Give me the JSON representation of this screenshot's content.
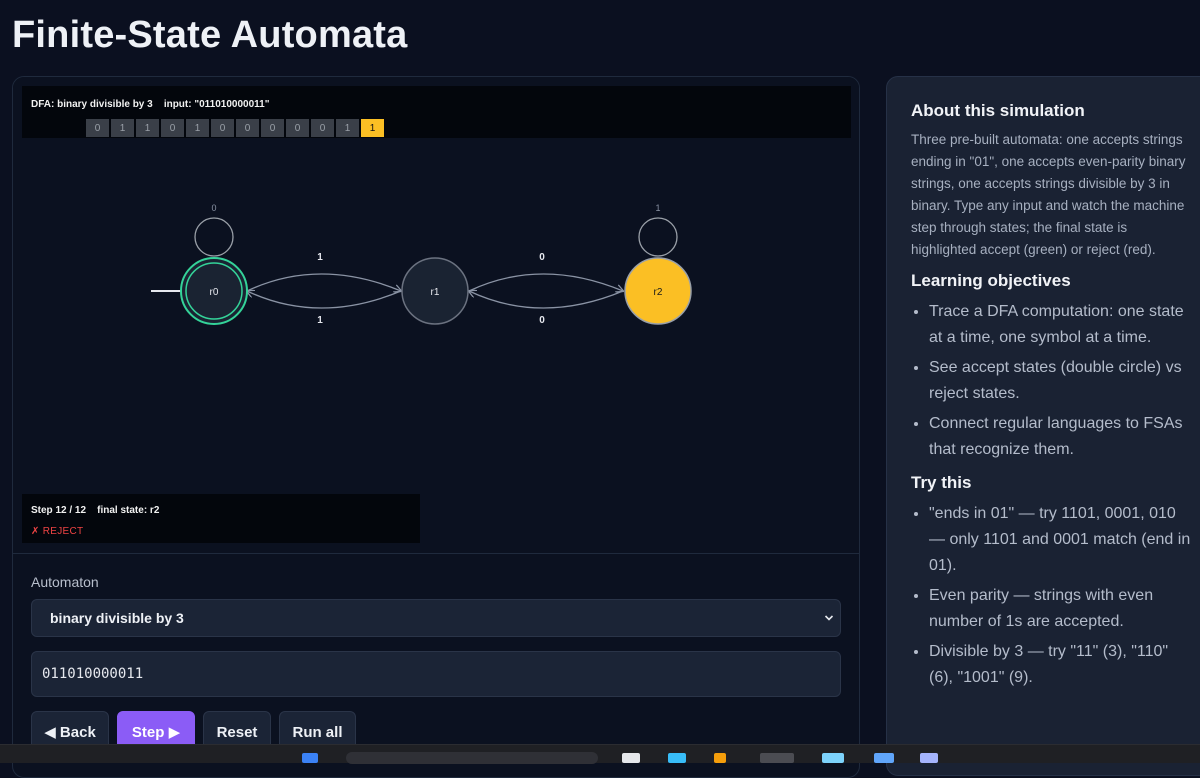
{
  "page": {
    "title": "Finite-State Automata"
  },
  "simulation": {
    "header_label": "DFA: binary divisible by 3    input: \"011010000011\"",
    "tape": [
      "0",
      "1",
      "1",
      "0",
      "1",
      "0",
      "0",
      "0",
      "0",
      "0",
      "1",
      "1"
    ],
    "active_index": 11,
    "states": [
      {
        "id": "r0",
        "label": "r0",
        "start": true,
        "accept": true,
        "active": false,
        "self_loop": "0"
      },
      {
        "id": "r1",
        "label": "r1",
        "start": false,
        "accept": false,
        "active": false,
        "self_loop": null
      },
      {
        "id": "r2",
        "label": "r2",
        "start": false,
        "accept": false,
        "active": true,
        "self_loop": "1"
      }
    ],
    "transitions": [
      {
        "from": "r0",
        "to": "r1",
        "label": "1"
      },
      {
        "from": "r1",
        "to": "r0",
        "label": "1"
      },
      {
        "from": "r1",
        "to": "r2",
        "label": "0"
      },
      {
        "from": "r2",
        "to": "r1",
        "label": "0"
      }
    ],
    "status": {
      "step_text": "Step 12 / 12    final state: r2",
      "verdict": "✗ REJECT"
    },
    "colors": {
      "accept": "#34d399",
      "active": "#fbbf24",
      "reject": "#ef4444"
    }
  },
  "controls": {
    "automaton_label": "Automaton",
    "automaton_selected": "binary divisible by 3",
    "input_value": "011010000011",
    "buttons": {
      "back": "◀ Back",
      "step": "Step ▶",
      "reset": "Reset",
      "run_all": "Run all"
    }
  },
  "about": {
    "title": "About this simulation",
    "text": "Three pre-built automata: one accepts strings ending in \"01\", one accepts even-parity binary strings, one accepts strings divisible by 3 in binary. Type any input and watch the machine step through states; the final state is highlighted accept (green) or reject (red).",
    "objectives_title": "Learning objectives",
    "objectives": [
      "Trace a DFA computation: one state at a time, one symbol at a time.",
      "See accept states (double circle) vs reject states.",
      "Connect regular languages to FSAs that recognize them."
    ],
    "try_title": "Try this",
    "try_items": [
      "\"ends in 01\" — try 1101, 0001, 010 — only 1101 and 0001 match (end in 01).",
      "Even parity — strings with even number of 1s are accepted.",
      "Divisible by 3 — try \"11\" (3), \"110\" (6), \"1001\" (9)."
    ]
  }
}
